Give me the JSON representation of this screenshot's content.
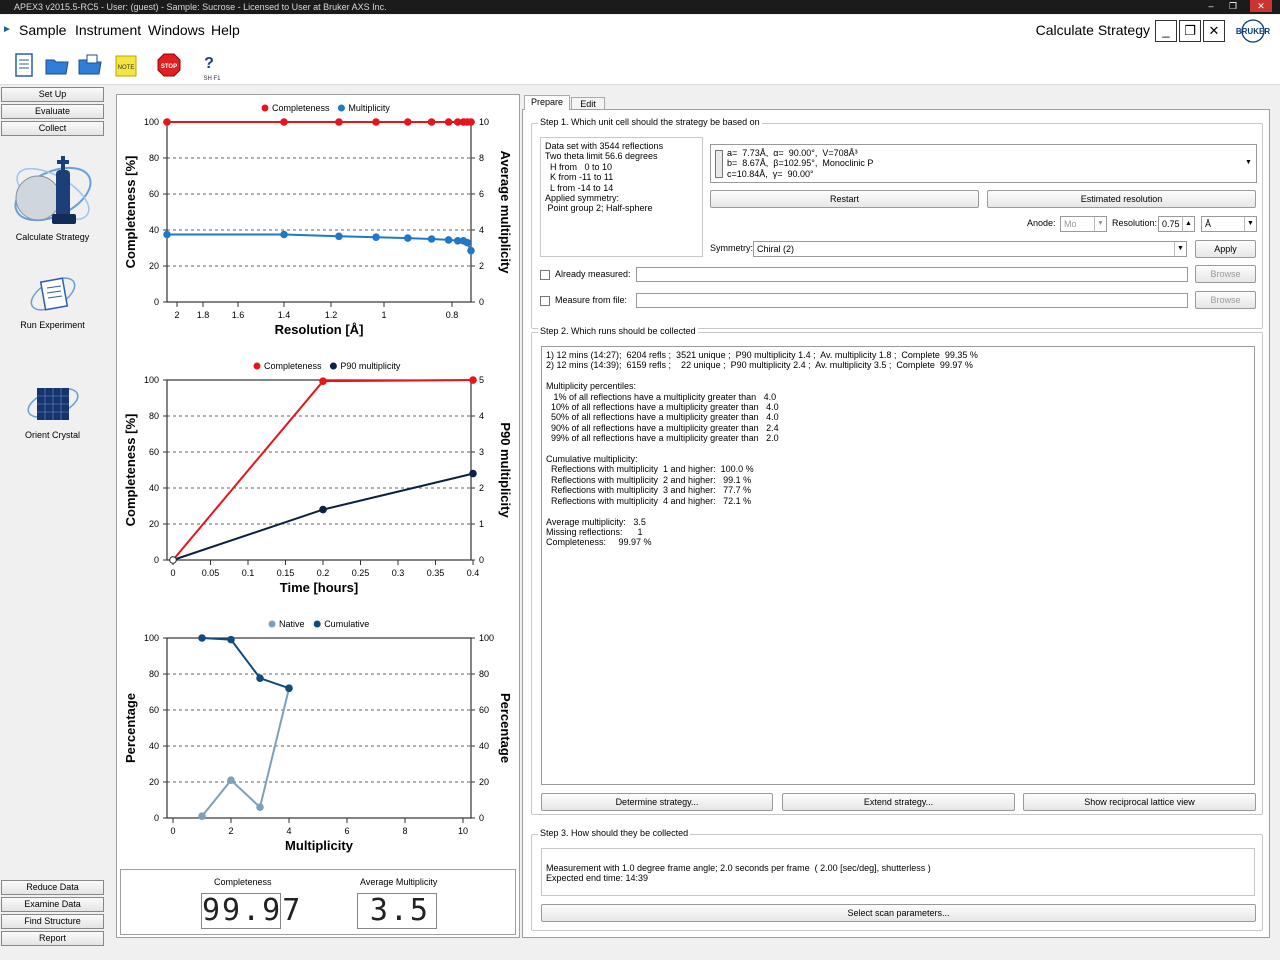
{
  "window": {
    "title": "APEX3 v2015.5-RC5 - User: (guest) - Sample: Sucrose - Licensed to User at Bruker AXS Inc."
  },
  "menu": {
    "items": [
      "Sample",
      "Instrument",
      "Windows",
      "Help"
    ],
    "app_title": "Calculate Strategy",
    "brand": "BRUKER"
  },
  "toolbar": {
    "note_label": "NOTE",
    "stop_label": "STOP",
    "help_label": "SH F1"
  },
  "left_nav": {
    "top": [
      "Set Up",
      "Evaluate",
      "Collect"
    ],
    "big": [
      "Calculate Strategy",
      "Run Experiment",
      "Orient Crystal"
    ],
    "bottom": [
      "Reduce Data",
      "Examine Data",
      "Find Structure",
      "Report"
    ]
  },
  "readouts": {
    "completeness_label": "Completeness",
    "completeness_value": "99.97",
    "multiplicity_label": "Average Multiplicity",
    "multiplicity_value": "3.5"
  },
  "tabs": [
    "Prepare",
    "Edit"
  ],
  "step1": {
    "title": "Step 1. Which unit cell should the strategy be based on",
    "info": "Data set with 3544 reflections\nTwo theta limit 56.6 degrees\n  H from   0 to 10\n  K from -11 to 11\n  L from -14 to 14\nApplied symmetry:\n Point group 2; Half-sphere",
    "cell": "a=  7.73Å,  α=  90.00°,  V=708Å³\nb=  8.67Å,  β=102.95°,  Monoclinic P\nc=10.84Å,  γ=  90.00°",
    "restart": "Restart",
    "estimated": "Estimated resolution",
    "anode_label": "Anode:",
    "anode_value": "Mo",
    "resolution_label": "Resolution:",
    "resolution_value": "0.75",
    "resolution_unit": "Å",
    "symmetry_label": "Symmetry:",
    "symmetry_value": "Chiral (2)",
    "apply": "Apply",
    "already_measured": "Already measured:",
    "measure_from_file": "Measure from file:",
    "browse": "Browse"
  },
  "step2": {
    "title": "Step 2. Which runs should be collected",
    "text": "1) 12 mins (14:27);  6204 refls ;  3521 unique ;  P90 multiplicity 1.4 ;  Av. multiplicity 1.8 ;  Complete  99.35 %\n2) 12 mins (14:39);  6159 refls ;    22 unique ;  P90 multiplicity 2.4 ;  Av. multiplicity 3.5 ;  Complete  99.97 %\n\nMultiplicity percentiles:\n   1% of all reflections have a multiplicity greater than   4.0\n  10% of all reflections have a multiplicity greater than   4.0\n  50% of all reflections have a multiplicity greater than   4.0\n  90% of all reflections have a multiplicity greater than   2.4\n  99% of all reflections have a multiplicity greater than   2.0\n\nCumulative multiplicity:\n  Reflections with multiplicity  1 and higher:  100.0 %\n  Reflections with multiplicity  2 and higher:   99.1 %\n  Reflections with multiplicity  3 and higher:   77.7 %\n  Reflections with multiplicity  4 and higher:   72.1 %\n\nAverage multiplicity:   3.5\nMissing reflections:      1\nCompleteness:     99.97 %",
    "determine": "Determine strategy...",
    "extend": "Extend strategy...",
    "reciprocal": "Show reciprocal lattice view"
  },
  "step3": {
    "title": "Step 3. How should they be collected",
    "text": "Measurement with 1.0 degree frame angle; 2.0 seconds per frame  ( 2.00 [sec/deg], shutterless )\nExpected end time: 14:39",
    "select": "Select scan parameters..."
  },
  "chart_data": [
    {
      "type": "line",
      "legend": [
        "Completeness",
        "Multiplicity"
      ],
      "xlabel": "Resolution [Å]",
      "ylabel": "Completeness [%]",
      "y2label": "Average multiplicity",
      "x_ticks": [
        "2",
        "1.8",
        "1.6",
        "1.4",
        "1.2",
        "1",
        "0.8"
      ],
      "y_ticks": [
        "0",
        "20",
        "40",
        "60",
        "80",
        "100"
      ],
      "y2_ticks": [
        "0",
        "2",
        "4",
        "6",
        "8",
        "10"
      ],
      "ylim": [
        0,
        100
      ],
      "y2lim": [
        0,
        10
      ],
      "series": [
        {
          "name": "Completeness",
          "color": "#e8141b",
          "axis": "left",
          "x": [
            2.05,
            1.4,
            1.17,
            1.03,
            0.93,
            0.86,
            0.81,
            0.77,
            0.74,
            0.72,
            0.7
          ],
          "y": [
            100,
            100,
            100,
            100,
            100,
            100,
            100,
            100,
            100,
            100,
            100
          ]
        },
        {
          "name": "Multiplicity",
          "color": "#1f78c8",
          "axis": "right",
          "x": [
            2.05,
            1.4,
            1.17,
            1.03,
            0.93,
            0.86,
            0.81,
            0.77,
            0.74,
            0.72,
            0.7
          ],
          "y": [
            3.75,
            3.75,
            3.65,
            3.6,
            3.55,
            3.5,
            3.45,
            3.4,
            3.4,
            3.3,
            2.85
          ]
        }
      ]
    },
    {
      "type": "line",
      "legend": [
        "Completeness",
        "P90 multiplicity"
      ],
      "xlabel": "Time [hours]",
      "ylabel": "Completeness [%]",
      "y2label": "P90 multiplicity",
      "x_ticks": [
        "0",
        "0.05",
        "0.1",
        "0.15",
        "0.2",
        "0.25",
        "0.3",
        "0.35",
        "0.4"
      ],
      "y_ticks": [
        "0",
        "20",
        "40",
        "60",
        "80",
        "100"
      ],
      "y2_ticks": [
        "0",
        "1",
        "2",
        "3",
        "4",
        "5"
      ],
      "xlim": [
        0,
        0.4
      ],
      "ylim": [
        0,
        100
      ],
      "y2lim": [
        0,
        5
      ],
      "series": [
        {
          "name": "Completeness",
          "color": "#e8141b",
          "axis": "left",
          "x": [
            0,
            0.2,
            0.4
          ],
          "y": [
            0,
            99.35,
            99.97
          ]
        },
        {
          "name": "P90 multiplicity",
          "color": "#0d2240",
          "axis": "right",
          "x": [
            0,
            0.2,
            0.4
          ],
          "y": [
            0,
            1.4,
            2.4
          ]
        }
      ]
    },
    {
      "type": "line",
      "legend": [
        "Native",
        "Cumulative"
      ],
      "xlabel": "Multiplicity",
      "ylabel": "Percentage",
      "y2label": "Percentage",
      "x_ticks": [
        "0",
        "2",
        "4",
        "6",
        "8",
        "10"
      ],
      "y_ticks": [
        "0",
        "20",
        "40",
        "60",
        "80",
        "100"
      ],
      "y2_ticks": [
        "0",
        "20",
        "40",
        "60",
        "80",
        "100"
      ],
      "xlim": [
        0,
        10
      ],
      "ylim": [
        0,
        100
      ],
      "series": [
        {
          "name": "Native",
          "color": "#7f9fb8",
          "axis": "left",
          "x": [
            1,
            2,
            3,
            4
          ],
          "y": [
            1,
            21,
            6,
            72
          ]
        },
        {
          "name": "Cumulative",
          "color": "#124a7a",
          "axis": "left",
          "x": [
            1,
            2,
            3,
            4
          ],
          "y": [
            100,
            99.1,
            77.7,
            72.1
          ]
        }
      ]
    }
  ]
}
